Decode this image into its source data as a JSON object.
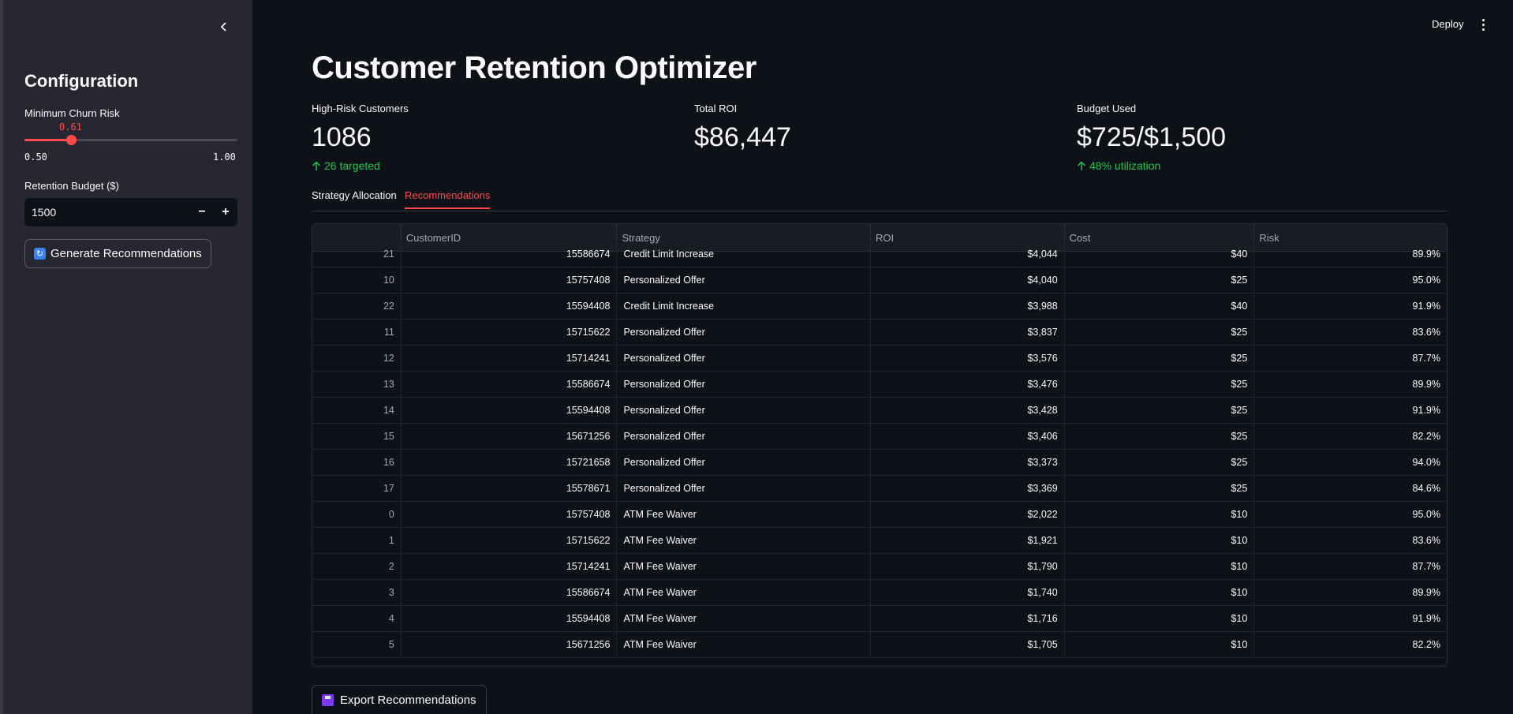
{
  "sidebar": {
    "title": "Configuration",
    "churn_slider": {
      "label": "Minimum Churn Risk",
      "value": "0.61",
      "min": "0.50",
      "max": "1.00",
      "fraction": 0.22
    },
    "budget": {
      "label": "Retention Budget ($)",
      "value": "1500",
      "minus": "−",
      "plus": "+"
    },
    "generate_label": "Generate Recommendations"
  },
  "header": {
    "deploy_label": "Deploy"
  },
  "main": {
    "title": "Customer Retention Optimizer",
    "metrics": [
      {
        "label": "High-Risk Customers",
        "value": "1086",
        "delta": "26 targeted"
      },
      {
        "label": "Total ROI",
        "value": "$86,447",
        "delta": ""
      },
      {
        "label": "Budget Used",
        "value": "$725/$1,500",
        "delta": "48% utilization"
      }
    ],
    "tabs": [
      {
        "label": "Strategy Allocation",
        "active": false
      },
      {
        "label": "Recommendations",
        "active": true
      }
    ],
    "table": {
      "columns": [
        "",
        "CustomerID",
        "Strategy",
        "ROI",
        "Cost",
        "Risk"
      ],
      "rows": [
        [
          "21",
          "15586674",
          "Credit Limit Increase",
          "$4,044",
          "$40",
          "89.9%"
        ],
        [
          "10",
          "15757408",
          "Personalized Offer",
          "$4,040",
          "$25",
          "95.0%"
        ],
        [
          "22",
          "15594408",
          "Credit Limit Increase",
          "$3,988",
          "$40",
          "91.9%"
        ],
        [
          "11",
          "15715622",
          "Personalized Offer",
          "$3,837",
          "$25",
          "83.6%"
        ],
        [
          "12",
          "15714241",
          "Personalized Offer",
          "$3,576",
          "$25",
          "87.7%"
        ],
        [
          "13",
          "15586674",
          "Personalized Offer",
          "$3,476",
          "$25",
          "89.9%"
        ],
        [
          "14",
          "15594408",
          "Personalized Offer",
          "$3,428",
          "$25",
          "91.9%"
        ],
        [
          "15",
          "15671256",
          "Personalized Offer",
          "$3,406",
          "$25",
          "82.2%"
        ],
        [
          "16",
          "15721658",
          "Personalized Offer",
          "$3,373",
          "$25",
          "94.0%"
        ],
        [
          "17",
          "15578671",
          "Personalized Offer",
          "$3,369",
          "$25",
          "84.6%"
        ],
        [
          "0",
          "15757408",
          "ATM Fee Waiver",
          "$2,022",
          "$10",
          "95.0%"
        ],
        [
          "1",
          "15715622",
          "ATM Fee Waiver",
          "$1,921",
          "$10",
          "83.6%"
        ],
        [
          "2",
          "15714241",
          "ATM Fee Waiver",
          "$1,790",
          "$10",
          "87.7%"
        ],
        [
          "3",
          "15586674",
          "ATM Fee Waiver",
          "$1,740",
          "$10",
          "89.9%"
        ],
        [
          "4",
          "15594408",
          "ATM Fee Waiver",
          "$1,716",
          "$10",
          "91.9%"
        ],
        [
          "5",
          "15671256",
          "ATM Fee Waiver",
          "$1,705",
          "$10",
          "82.2%"
        ]
      ]
    },
    "export_label": "Export Recommendations"
  },
  "colors": {
    "accent": "#ff4b4b",
    "positive": "#21c354",
    "sidebar_bg": "#262730",
    "main_bg": "#0e1117"
  },
  "icons": {
    "collapse": "chevron-left-icon",
    "menu": "kebab-menu-icon",
    "delta": "arrow-up-icon",
    "generate": "refresh-icon",
    "export": "floppy-disk-icon"
  }
}
